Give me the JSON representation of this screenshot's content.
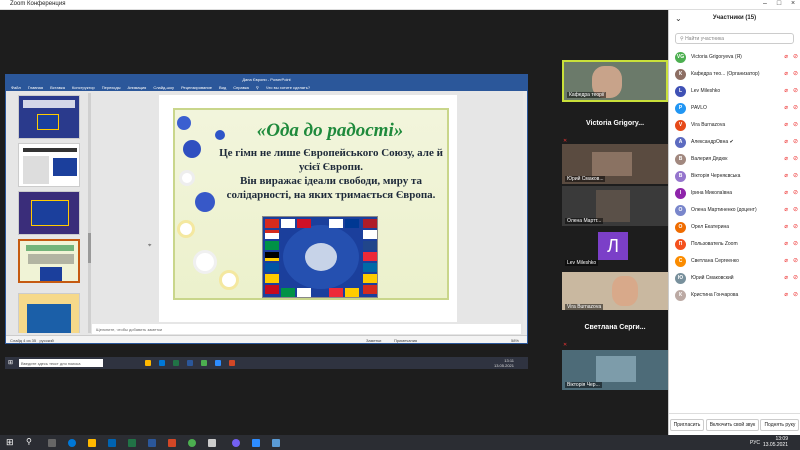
{
  "zoom": {
    "title": "Zoom Конференция"
  },
  "ppt": {
    "title": "Дана Європи - PowerPoint",
    "tabs": [
      "Файл",
      "Главная",
      "Вставка",
      "Конструктор",
      "Переходы",
      "Анимация",
      "Слайд-шоу",
      "Рецензирование",
      "Вид",
      "Справка"
    ],
    "search_hint": "Что вы хотите сделать?",
    "notes_placeholder": "Щелкните, чтобы добавить заметки",
    "status_left": "Слайд 4 из 35",
    "status_lang": "русский",
    "status_notes": "Заметки",
    "status_comments": "Примечания",
    "zoom_level": "58%"
  },
  "slide": {
    "title": "«Ода до радості»",
    "line1": "Це гімн не лише Європейського Союзу, але й усієї Європи.",
    "line2": "Він виражає ідеали свободи, миру та солідарності, на яких тримається Європа."
  },
  "thumbs": [
    "2",
    "3",
    "",
    "4",
    ""
  ],
  "inner_taskbar": {
    "search": "Введите здесь текст для поиска",
    "time": "13:11",
    "date": "13.05.2021"
  },
  "gallery": {
    "tiles": [
      {
        "label": "Кафедра теорії"
      },
      {
        "name": "Victoria Grigory..."
      },
      {
        "label": "Юрий Смаков..."
      },
      {
        "label": "Олена Мартт..."
      },
      {
        "label": "Lev Mileshko",
        "letter": "Л"
      },
      {
        "label": "Vira Burnazova"
      },
      {
        "name": "Светлана Серги..."
      },
      {
        "label": "Вікторія Чер..."
      }
    ]
  },
  "participants": {
    "title": "Участники (15)",
    "search_placeholder": "Найти участника",
    "list": [
      {
        "initials": "VG",
        "name": "Victoria Grigoryeva (Я)",
        "color": "#4caf50"
      },
      {
        "initials": "К",
        "name": "Кафедра тео... (Организатор)",
        "color": "#8d6e63"
      },
      {
        "initials": "L",
        "name": "Lev Mileshko",
        "color": "#3f51b5"
      },
      {
        "initials": "P",
        "name": "PAVLO",
        "color": "#2196f3"
      },
      {
        "initials": "V",
        "name": "Vira Burnazova",
        "color": "#e64a19"
      },
      {
        "initials": "А",
        "name": "АлександрОвна ✔",
        "color": "#5c6bc0"
      },
      {
        "initials": "В",
        "name": "Валерия Дядюк",
        "color": "#a1887f"
      },
      {
        "initials": "В",
        "name": "Вікторія Черняєвська",
        "color": "#9575cd"
      },
      {
        "initials": "І",
        "name": "Ірина Миколаївна",
        "color": "#8e24aa"
      },
      {
        "initials": "О",
        "name": "Олена Мартиненко (доцент)",
        "color": "#7986cb"
      },
      {
        "initials": "О",
        "name": "Орел Екатерина",
        "color": "#ef6c00"
      },
      {
        "initials": "П",
        "name": "Пользователь Zoom",
        "color": "#f4511e"
      },
      {
        "initials": "С",
        "name": "Светлана Сергеенко",
        "color": "#fb8c00"
      },
      {
        "initials": "Ю",
        "name": "Юрий Смаковский",
        "color": "#78909c"
      },
      {
        "initials": "К",
        "name": "Кристина Гончарова",
        "color": "#bcaaa4"
      }
    ],
    "invite": "Пригласить",
    "mute_own": "Включить свой звук",
    "raise_hand": "Поднять руку"
  },
  "taskbar": {
    "lang": "РУС",
    "time": "13:09",
    "date": "13.05.2021"
  }
}
